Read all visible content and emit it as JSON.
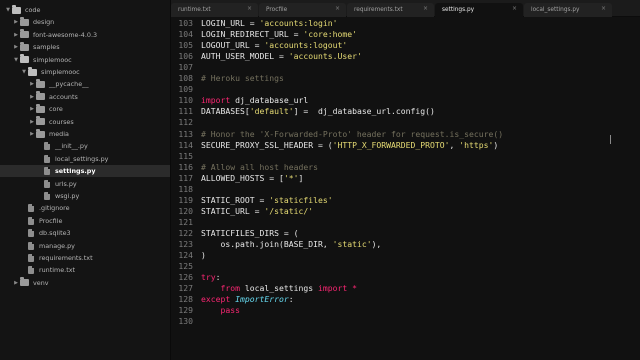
{
  "colors": {
    "sidebar_bg": "#141414",
    "editor_bg": "#111111",
    "string": "#e6db74",
    "keyword": "#f92672",
    "comment": "#75715e",
    "class_name": "#66d9ef"
  },
  "sidebar": {
    "items": [
      {
        "label": "code",
        "kind": "folder-open",
        "expanded": true
      },
      {
        "label": "design",
        "kind": "folder",
        "expanded": false
      },
      {
        "label": "font-awesome-4.0.3",
        "kind": "folder",
        "expanded": false
      },
      {
        "label": "samples",
        "kind": "folder",
        "expanded": false
      },
      {
        "label": "simplemooc",
        "kind": "folder-open",
        "expanded": true
      },
      {
        "label": "simplemooc",
        "kind": "folder-open",
        "expanded": true
      },
      {
        "label": "__pycache__",
        "kind": "folder",
        "expanded": false
      },
      {
        "label": "accounts",
        "kind": "folder",
        "expanded": false
      },
      {
        "label": "core",
        "kind": "folder",
        "expanded": false
      },
      {
        "label": "courses",
        "kind": "folder",
        "expanded": false
      },
      {
        "label": "media",
        "kind": "folder",
        "expanded": false
      },
      {
        "label": "__init__.py",
        "kind": "file"
      },
      {
        "label": "local_settings.py",
        "kind": "file"
      },
      {
        "label": "settings.py",
        "kind": "file",
        "selected": true
      },
      {
        "label": "urls.py",
        "kind": "file"
      },
      {
        "label": "wsgi.py",
        "kind": "file"
      },
      {
        "label": ".gitignore",
        "kind": "file"
      },
      {
        "label": "Procfile",
        "kind": "file"
      },
      {
        "label": "db.sqlite3",
        "kind": "file"
      },
      {
        "label": "manage.py",
        "kind": "file"
      },
      {
        "label": "requirements.txt",
        "kind": "file"
      },
      {
        "label": "runtime.txt",
        "kind": "file"
      },
      {
        "label": "venv",
        "kind": "folder",
        "expanded": false
      }
    ]
  },
  "tabs": [
    {
      "label": "runtime.txt",
      "active": false
    },
    {
      "label": "Procfile",
      "active": false
    },
    {
      "label": "requirements.txt",
      "active": false
    },
    {
      "label": "settings.py",
      "active": true
    },
    {
      "label": "local_settings.py",
      "active": false
    }
  ],
  "tab_close": "×",
  "editor": {
    "lines": [
      {
        "n": "103",
        "tokens": [
          [
            "p",
            "LOGIN_URL = "
          ],
          [
            "s",
            "'accounts:login'"
          ]
        ]
      },
      {
        "n": "104",
        "tokens": [
          [
            "p",
            "LOGIN_REDIRECT_URL = "
          ],
          [
            "s",
            "'core:home'"
          ]
        ]
      },
      {
        "n": "105",
        "tokens": [
          [
            "p",
            "LOGOUT_URL = "
          ],
          [
            "s",
            "'accounts:logout'"
          ]
        ]
      },
      {
        "n": "106",
        "tokens": [
          [
            "p",
            "AUTH_USER_MODEL = "
          ],
          [
            "s",
            "'accounts.User'"
          ]
        ]
      },
      {
        "n": "107",
        "tokens": []
      },
      {
        "n": "108",
        "tokens": [
          [
            "c",
            "# Heroku settings"
          ]
        ]
      },
      {
        "n": "109",
        "tokens": []
      },
      {
        "n": "110",
        "tokens": [
          [
            "k",
            "import"
          ],
          [
            "p",
            " dj_database_url"
          ]
        ]
      },
      {
        "n": "111",
        "tokens": [
          [
            "p",
            "DATABASES["
          ],
          [
            "s",
            "'default'"
          ],
          [
            "p",
            "] =  dj_database_url.config()"
          ]
        ]
      },
      {
        "n": "112",
        "tokens": []
      },
      {
        "n": "113",
        "tokens": [
          [
            "c",
            "# Honor the 'X-Forwarded-Proto' header for request.is_secure()"
          ]
        ]
      },
      {
        "n": "114",
        "tokens": [
          [
            "p",
            "SECURE_PROXY_SSL_HEADER = ("
          ],
          [
            "s",
            "'HTTP_X_FORWARDED_PROTO'"
          ],
          [
            "p",
            ", "
          ],
          [
            "s",
            "'https'"
          ],
          [
            "p",
            ")"
          ]
        ]
      },
      {
        "n": "115",
        "tokens": []
      },
      {
        "n": "116",
        "tokens": [
          [
            "c",
            "# Allow all host headers"
          ]
        ]
      },
      {
        "n": "117",
        "tokens": [
          [
            "p",
            "ALLOWED_HOSTS = ["
          ],
          [
            "s",
            "'*'"
          ],
          [
            "p",
            "]"
          ]
        ]
      },
      {
        "n": "118",
        "tokens": []
      },
      {
        "n": "119",
        "tokens": [
          [
            "p",
            "STATIC_ROOT = "
          ],
          [
            "s",
            "'staticfiles'"
          ]
        ]
      },
      {
        "n": "120",
        "tokens": [
          [
            "p",
            "STATIC_URL = "
          ],
          [
            "s",
            "'/static/'"
          ]
        ]
      },
      {
        "n": "121",
        "tokens": []
      },
      {
        "n": "122",
        "tokens": [
          [
            "p",
            "STATICFILES_DIRS = ("
          ]
        ]
      },
      {
        "n": "123",
        "tokens": [
          [
            "p",
            "    os.path.join(BASE_DIR, "
          ],
          [
            "s",
            "'static'"
          ],
          [
            "p",
            "),"
          ]
        ]
      },
      {
        "n": "124",
        "tokens": [
          [
            "p",
            ")"
          ]
        ]
      },
      {
        "n": "125",
        "tokens": []
      },
      {
        "n": "126",
        "tokens": [
          [
            "k",
            "try"
          ],
          [
            "p",
            ":"
          ]
        ]
      },
      {
        "n": "127",
        "tokens": [
          [
            "p",
            "    "
          ],
          [
            "k",
            "from"
          ],
          [
            "p",
            " local_settings "
          ],
          [
            "k",
            "import"
          ],
          [
            "p",
            " "
          ],
          [
            "k",
            "*"
          ]
        ]
      },
      {
        "n": "128",
        "tokens": [
          [
            "k",
            "except"
          ],
          [
            "p",
            " "
          ],
          [
            "cls",
            "ImportError"
          ],
          [
            "p",
            ":"
          ]
        ]
      },
      {
        "n": "129",
        "tokens": [
          [
            "p",
            "    "
          ],
          [
            "k",
            "pass"
          ]
        ]
      },
      {
        "n": "130",
        "tokens": []
      }
    ]
  }
}
